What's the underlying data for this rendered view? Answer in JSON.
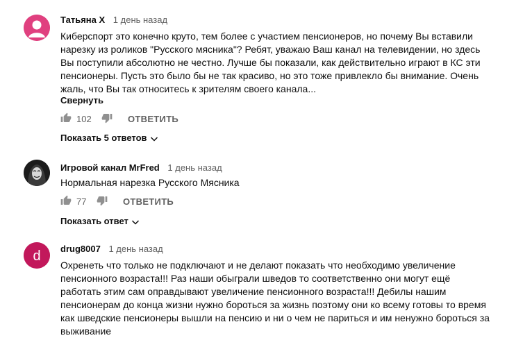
{
  "comments": [
    {
      "author": "Татьяна Х",
      "time": "1 день назад",
      "avatar_color": "#e0407f",
      "lines": [
        "Киберспорт это конечно круто, тем более с участием пенсионеров, но почему Вы вставили",
        "нарезку из роликов \"Русского мясника\"? Ребят, уважаю Ваш канал на телевидении, но здесь",
        "Вы поступили абсолютно не честно. Лучше бы показали, как действительно играют в КС эти",
        "пенсионеры. Пусть это было бы не так красиво, но это тоже привлекло бы внимание. Очень",
        "жаль, что Вы так относитесь к зрителям своего канала..."
      ],
      "collapse_label": "Свернуть",
      "likes": "102",
      "reply_label": "ОТВЕТИТЬ",
      "replies_label": "Показать 5 ответов"
    },
    {
      "author": "Игровой канал MrFred",
      "time": "1 день назад",
      "lines": [
        "Нормальная нарезка Русского Мясника"
      ],
      "likes": "77",
      "reply_label": "ОТВЕТИТЬ",
      "replies_label": "Показать ответ"
    },
    {
      "author": "drug8007",
      "time": "1 день назад",
      "avatar_letter": "d",
      "avatar_color": "#c2185b",
      "lines": [
        "Охренеть что только не подключают и не делают показать что необходимо увеличение",
        "пенсионного возраста!!! Раз наши обыграли шведов то соответственно они могут ещё",
        "работать этим сам оправдывают увеличение пенсионного возраста!!! Дебилы нашим",
        "пенсионерам до конца жизни нужно бороться за жизнь поэтому они ко всему готовы то время",
        "как шведские пенсионеры вышли на пенсию и ни о чем не париться и им ненужно бороться за",
        "выживание"
      ]
    }
  ]
}
